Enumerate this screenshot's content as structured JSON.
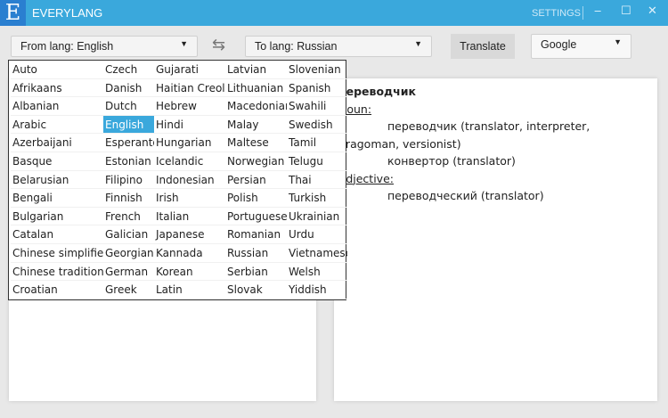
{
  "app": {
    "logo": "E",
    "title": "EVERYLANG",
    "settings": "SETTINGS",
    "minimize": "‒",
    "maximize": "☐",
    "close": "✕"
  },
  "toolbar": {
    "from": "From lang: English",
    "to": "To lang: Russian",
    "swap": "⇆",
    "translate": "Translate",
    "engine": "Google",
    "arrow": "▼"
  },
  "result": {
    "headword": "переводчик",
    "noun_label": "Noun:",
    "noun": [
      "переводчик (translator, interpreter, dragoman, versionist)",
      "конвертор (translator)"
    ],
    "adj_label": "Adjective:",
    "adj": [
      "переводческий (translator)"
    ]
  },
  "languages": {
    "selected": "English",
    "columns": [
      [
        "Auto",
        "Afrikaans",
        "Albanian",
        "Arabic",
        "Azerbaijani",
        "Basque",
        "Belarusian",
        "Bengali",
        "Bulgarian",
        "Catalan",
        "Chinese simplified",
        "Chinese traditional",
        "Croatian"
      ],
      [
        "Czech",
        "Danish",
        "Dutch",
        "English",
        "Esperanto",
        "Estonian",
        "Filipino",
        "Finnish",
        "French",
        "Galician",
        "Georgian",
        "German",
        "Greek"
      ],
      [
        "Gujarati",
        "Haitian Creole",
        "Hebrew",
        "Hindi",
        "Hungarian",
        "Icelandic",
        "Indonesian",
        "Irish",
        "Italian",
        "Japanese",
        "Kannada",
        "Korean",
        "Latin"
      ],
      [
        "Latvian",
        "Lithuanian",
        "Macedonian",
        "Malay",
        "Maltese",
        "Norwegian",
        "Persian",
        "Polish",
        "Portuguese",
        "Romanian",
        "Russian",
        "Serbian",
        "Slovak"
      ],
      [
        "Slovenian",
        "Spanish",
        "Swahili",
        "Swedish",
        "Tamil",
        "Telugu",
        "Thai",
        "Turkish",
        "Ukrainian",
        "Urdu",
        "Vietnamese",
        "Welsh",
        "Yiddish"
      ]
    ]
  }
}
